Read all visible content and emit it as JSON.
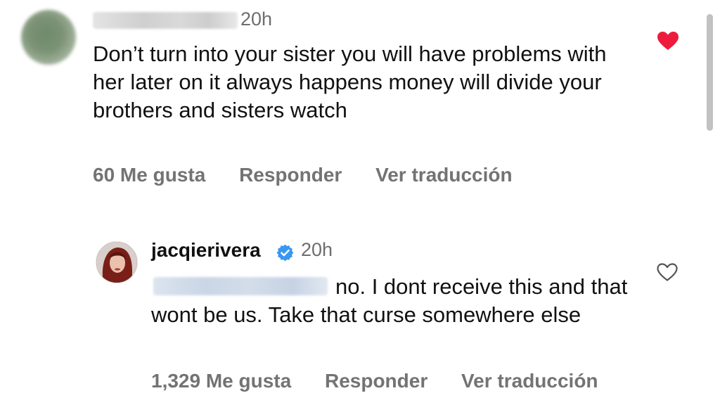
{
  "comment1": {
    "time": "20h",
    "text": "Don’t turn into your sister you will have problems with her later on it always happens money will divide your brothers and sisters watch",
    "likes": "60 Me gusta",
    "reply": "Responder",
    "translate": "Ver traducción",
    "liked_color": "#ed1c3c"
  },
  "comment2": {
    "username": "jacqierivera",
    "time": "20h",
    "text": "no. I dont receive  this and that wont be us.  Take that curse somewhere else",
    "likes": "1,329 Me gusta",
    "reply": "Responder",
    "translate": "Ver traducción",
    "verified_color": "#3897f0"
  },
  "icons": {
    "heart_filled": "heart-icon",
    "heart_outline": "heart-outline-icon",
    "verified": "verified-badge-icon"
  }
}
